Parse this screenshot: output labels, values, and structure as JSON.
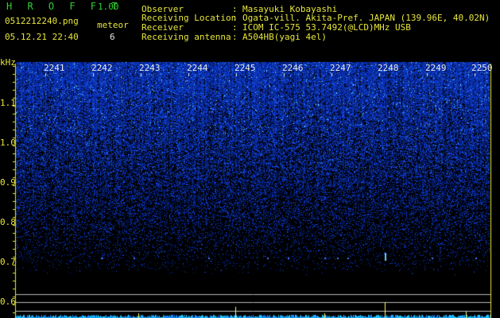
{
  "header": {
    "app_title": "H R O F F T",
    "version": "1.00",
    "file_name": "0512212240.png",
    "datetime": "05.12.21 22:40",
    "meteor_label": "meteor",
    "meteor_count": "6"
  },
  "info": [
    {
      "label": "Observer",
      "sep": ":",
      "value": "Masayuki Kobayashi"
    },
    {
      "label": "Receiving Location",
      "sep": ":",
      "value": "Ogata-vill. Akita-Pref. JAPAN (139.96E, 40.02N)"
    },
    {
      "label": "Receiver",
      "sep": ":",
      "value": "ICOM IC-575 53.7492(@LCD)MHz USB"
    },
    {
      "label": "Receiving antenna",
      "sep": ":",
      "value": "A504HB(yagi 4el)"
    }
  ],
  "chart_data": {
    "type": "heatmap",
    "ylabel": "kHz",
    "y_ticks": [
      "1.1",
      "1.0",
      "0.9",
      "0.8",
      "0.7",
      "0.6"
    ],
    "x_ticks": [
      "2241",
      "2242",
      "2243",
      "2244",
      "2245",
      "2246",
      "2247",
      "2248",
      "2249",
      "2250"
    ],
    "colors": {
      "text": "#e6e63a",
      "labels": "#e8e8e8",
      "signal": "#1a4cff",
      "strong": "#00ffff",
      "peak": "#ffff66"
    }
  }
}
